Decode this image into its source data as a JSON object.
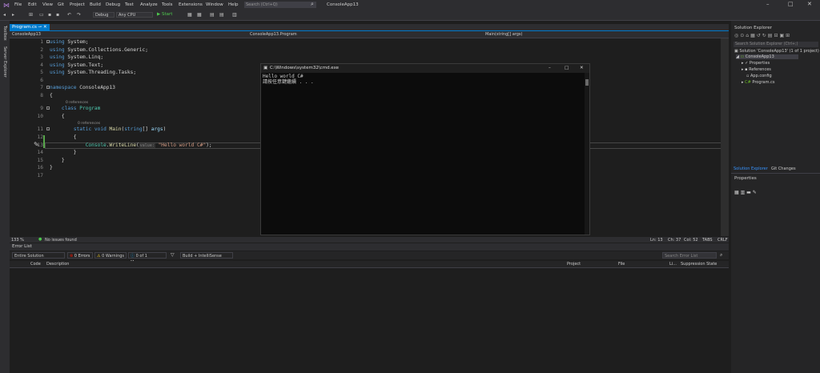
{
  "menu": [
    "File",
    "Edit",
    "View",
    "Git",
    "Project",
    "Build",
    "Debug",
    "Test",
    "Analyze",
    "Tools",
    "Extensions",
    "Window",
    "Help"
  ],
  "search": {
    "placeholder": "Search (Ctrl+Q)"
  },
  "app_title": "ConsoleApp13",
  "toolbar": {
    "config": "Debug",
    "platform": "Any CPU",
    "start": "Start"
  },
  "left_strip": [
    "Toolbox",
    "Server Explorer"
  ],
  "doc_tab": {
    "name": "Program.cs"
  },
  "nav": {
    "project": "ConsoleApp13",
    "class": "ConsoleApp13.Program",
    "member": "Main(string[] args)"
  },
  "editor": {
    "line_numbers": [
      "1",
      "2",
      "3",
      "4",
      "5",
      "6",
      "7",
      "8",
      "9",
      "10",
      "11",
      "12",
      "13",
      "14",
      "15",
      "16",
      "17"
    ],
    "references": "0 references"
  },
  "editor_status": {
    "zoom": "133 %",
    "issues": "No issues found",
    "ln": "Ln: 13",
    "ch": "Ch: 37",
    "col": "Col: 52",
    "tabs": "TABS",
    "crlf": "CRLF"
  },
  "console": {
    "title": "C:\\Windows\\system32\\cmd.exe",
    "line1": "Hello world C#",
    "line2": "請按任意鍵繼續 . . ."
  },
  "error_list": {
    "title": "Error List",
    "scope": "Entire Solution",
    "errors": "0 Errors",
    "warnings": "0 Warnings",
    "messages": "0 of 1 Message",
    "build": "Build + IntelliSense",
    "search_placeholder": "Search Error List",
    "columns": [
      "Code",
      "Description",
      "Project",
      "File",
      "Li...",
      "Suppression State"
    ]
  },
  "solution_explorer": {
    "title": "Solution Explorer",
    "search_placeholder": "Search Solution Explorer (Ctrl+;)",
    "items": [
      "Solution 'ConsoleApp13' (1 of 1 project)",
      "ConsoleApp13",
      "Properties",
      "References",
      "App.config",
      "Program.cs"
    ],
    "tabs": [
      "Solution Explorer",
      "Git Changes"
    ],
    "properties": "Properties"
  }
}
